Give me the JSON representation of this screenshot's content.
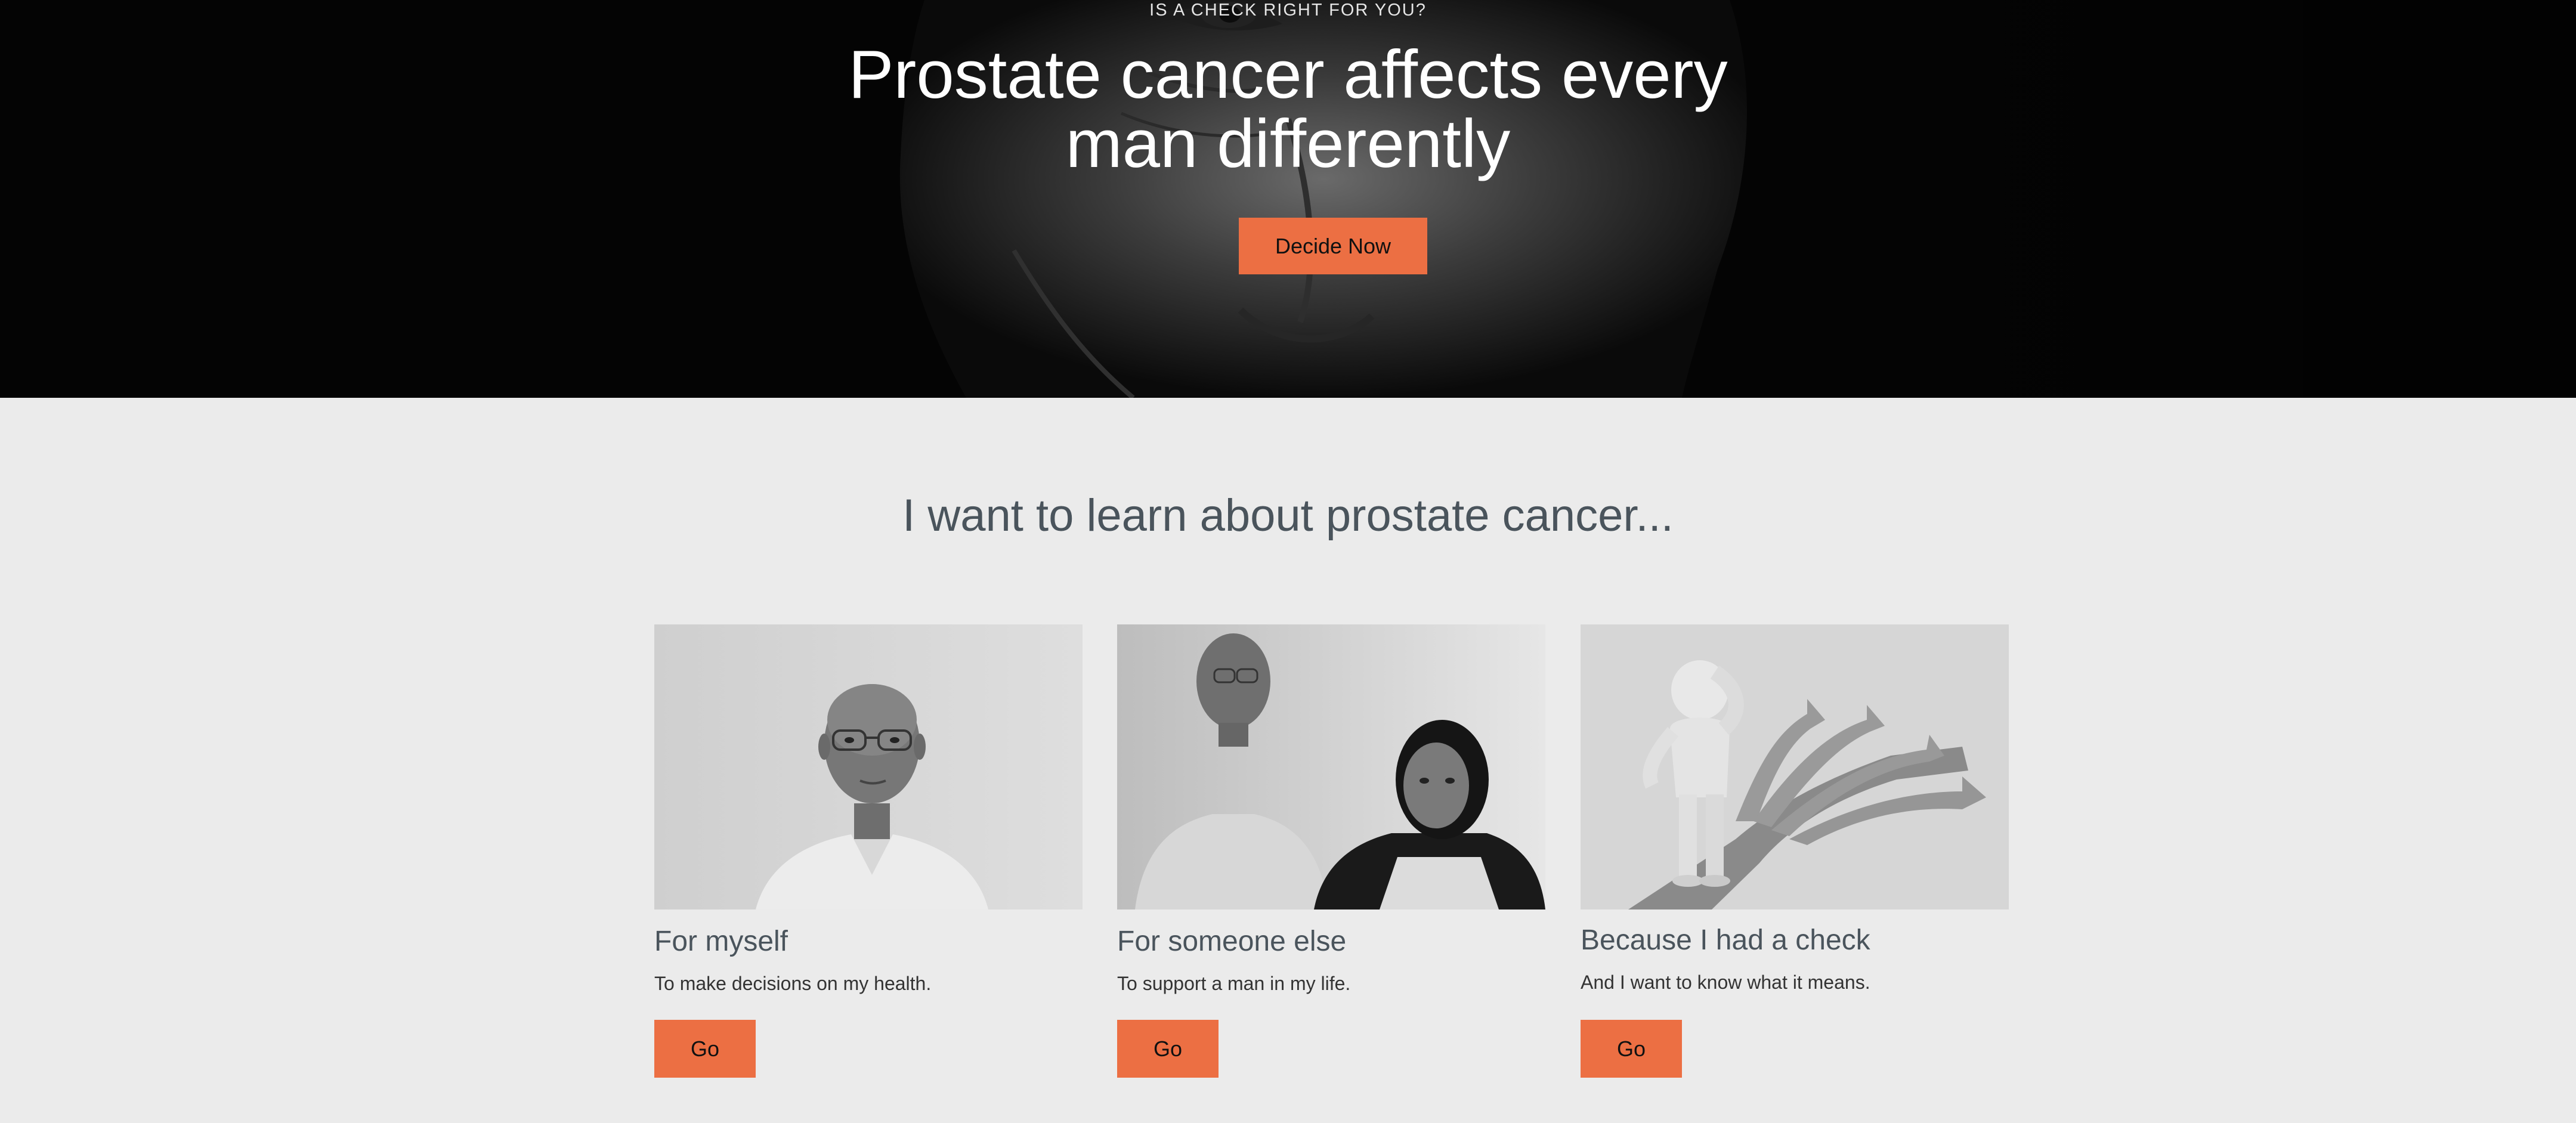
{
  "hero": {
    "eyebrow": "IS A CHECK RIGHT FOR YOU?",
    "title": "Prostate cancer affects every man differently",
    "button_label": "Decide Now"
  },
  "learn": {
    "heading": "I want to learn about prostate cancer...",
    "cards": [
      {
        "title": "For myself",
        "text": "To make decisions on my health.",
        "button_label": "Go"
      },
      {
        "title": "For someone else",
        "text": "To support a man in my life.",
        "button_label": "Go"
      },
      {
        "title": "Because I had a check",
        "text": "And I want to know what it means.",
        "button_label": "Go"
      }
    ]
  },
  "colors": {
    "accent": "#ec6f43",
    "heading": "#4a545c",
    "page_background": "#ebebeb",
    "hero_background": "#050505"
  }
}
